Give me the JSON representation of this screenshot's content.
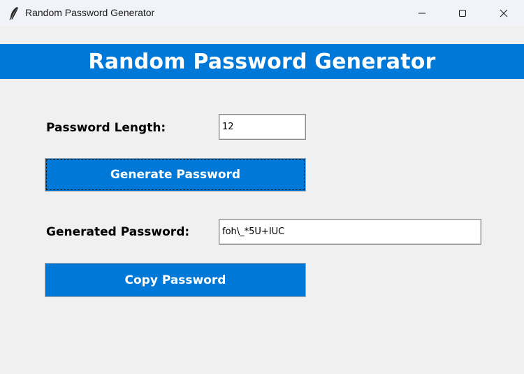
{
  "window": {
    "title": "Random Password Generator",
    "icon": "feather-icon",
    "controls": {
      "minimize_icon": "minimize-icon",
      "maximize_icon": "maximize-icon",
      "close_icon": "close-icon"
    }
  },
  "header": {
    "title": "Random Password Generator",
    "background": "#0078d7",
    "color": "#ffffff"
  },
  "form": {
    "length_label": "Password Length:",
    "length_value": "12",
    "generate_label": "Generate Password",
    "generated_label": "Generated Password:",
    "generated_value": "foh\\_*5U+IUC",
    "copy_label": "Copy Password"
  },
  "colors": {
    "accent": "#0078d7",
    "background": "#f0f0f0",
    "titlebar": "#f1f3f9"
  }
}
